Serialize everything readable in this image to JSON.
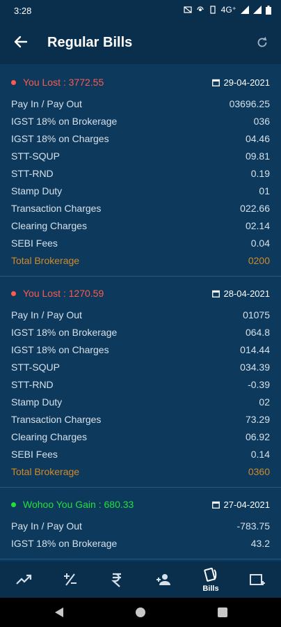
{
  "status_bar": {
    "time": "3:28",
    "network": "4G⁺"
  },
  "app_bar": {
    "title": "Regular Bills"
  },
  "bills": [
    {
      "type": "loss",
      "status_text": "You Lost : 3772.55",
      "date": "29-04-2021",
      "rows": [
        {
          "label": "Pay In / Pay Out",
          "value": "03696.25"
        },
        {
          "label": "IGST 18% on Brokerage",
          "value": "036"
        },
        {
          "label": "IGST 18% on Charges",
          "value": "04.46"
        },
        {
          "label": "STT-SQUP",
          "value": "09.81"
        },
        {
          "label": "STT-RND",
          "value": "0.19"
        },
        {
          "label": "Stamp Duty",
          "value": "01"
        },
        {
          "label": "Transaction Charges",
          "value": "022.66"
        },
        {
          "label": "Clearing Charges",
          "value": "02.14"
        },
        {
          "label": "SEBI Fees",
          "value": "0.04"
        },
        {
          "label": "Total Brokerage",
          "value": "0200"
        }
      ]
    },
    {
      "type": "loss",
      "status_text": "You Lost : 1270.59",
      "date": "28-04-2021",
      "rows": [
        {
          "label": "Pay In / Pay Out",
          "value": "01075"
        },
        {
          "label": "IGST 18% on Brokerage",
          "value": "064.8"
        },
        {
          "label": "IGST 18% on Charges",
          "value": "014.44"
        },
        {
          "label": "STT-SQUP",
          "value": "034.39"
        },
        {
          "label": "STT-RND",
          "value": "-0.39"
        },
        {
          "label": "Stamp Duty",
          "value": "02"
        },
        {
          "label": "Transaction Charges",
          "value": "73.29"
        },
        {
          "label": "Clearing Charges",
          "value": "06.92"
        },
        {
          "label": "SEBI Fees",
          "value": "0.14"
        },
        {
          "label": "Total Brokerage",
          "value": "0360"
        }
      ]
    },
    {
      "type": "gain",
      "status_text": "Wohoo You Gain : 680.33",
      "date": "27-04-2021",
      "rows": [
        {
          "label": "Pay In / Pay Out",
          "value": "-783.75"
        },
        {
          "label": "IGST 18% on Brokerage",
          "value": "43.2"
        }
      ]
    }
  ],
  "bottom_nav": [
    {
      "icon": "trending-up-icon",
      "label": ""
    },
    {
      "icon": "plus-minus-icon",
      "label": ""
    },
    {
      "icon": "rupee-icon",
      "label": ""
    },
    {
      "icon": "people-icon",
      "label": ""
    },
    {
      "icon": "bills-icon",
      "label": "Bills"
    },
    {
      "icon": "add-box-icon",
      "label": ""
    }
  ],
  "colors": {
    "loss": "#ff5a4d",
    "gain": "#22e03c",
    "total": "#d08a2a",
    "background": "#0d3a5c",
    "bar": "#0a2f4c"
  }
}
